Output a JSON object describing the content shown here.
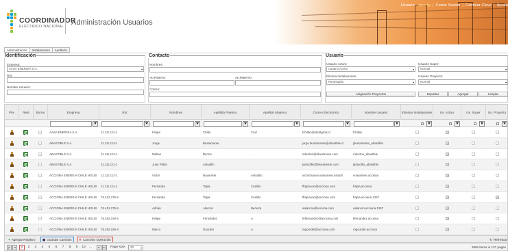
{
  "header": {
    "logo_line1": "COORDINADOR",
    "logo_line2": "ELÉCTRICO NACIONAL",
    "app_title": "Administración Usuarios",
    "user_prefix": "Usuario:",
    "user_name": "qwerty",
    "links": [
      "Cerrar Sesión",
      "Cambiar Clave",
      "Ayuda"
    ]
  },
  "tabs": [
    {
      "label": "Administración"
    },
    {
      "label": "Instalaciones"
    },
    {
      "label": "Auditoría"
    }
  ],
  "identificacion": {
    "legend": "Identificación",
    "empresa_label": "Empresa:",
    "empresa_value": "AASA ENERGÍA S.A.",
    "rut_label": "Rut:",
    "rut_value": "",
    "nombre_usuario_label": "Nombre Usuario:",
    "nombre_usuario_value": ""
  },
  "contacto": {
    "legend": "Contacto",
    "nombres_label": "Nombres:",
    "ap_paterno_label": "Ap.Paterno:",
    "ap_materno_label": "Ap.Materno:",
    "correo_label": "Correo:"
  },
  "usuario": {
    "legend": "Usuario",
    "usuario_activo_label": "Usuario Activo:",
    "usuario_activo_value": "Usuario Activo",
    "usuario_super_label": "Usuario Super:",
    "usuario_super_value": "Normal",
    "elimina_label": "Elimina Instalaciones:",
    "elimina_value": "Restringido",
    "usuario_proyecto_label": "Usuario Proyecto:",
    "usuario_proyecto_value": "Normal",
    "asignacion_button": "Asignación Proyectos",
    "exportar_button": "Exportar",
    "agregar_button": "Agregar",
    "limpiar_button": "Limpiar"
  },
  "grid": {
    "columns": [
      "Priv",
      "Rest",
      "Borrar",
      "Empresa",
      "Rut",
      "Nombres",
      "Apellido Paterno",
      "Apellido Materno",
      "Correo Electrónico",
      "Nombre Usuario",
      "Eliminar Instalaciones",
      "Us. Activo",
      "Us. Super",
      "Us. Proyecto"
    ],
    "rows": [
      {
        "empresa": "AASA ENERGÍA S.A.",
        "rut": "11.111.111-1",
        "nombres": "Felipe",
        "ap_paterno": "Chilla",
        "ap_materno": "Cruz",
        "correo": "fchillac@sbuttgmis.cl",
        "usuario": "fchillac",
        "elim": false,
        "activo": true,
        "super": false,
        "proyecto": false
      },
      {
        "empresa": "ABASTIBLE S.A.",
        "rut": "11.111.112-1",
        "nombres": "Jorge",
        "ap_paterno": "Bustamante",
        "ap_materno": "",
        "correo": "jorge.bustamante@abastible.cl",
        "usuario": "jbustamante_abastible",
        "elim": false,
        "activo": true,
        "super": false,
        "proyecto": false
      },
      {
        "empresa": "ABASTIBLE S.A.",
        "rut": "11.111.112-1",
        "nombres": "Matias",
        "ap_paterno": "Burton",
        "ap_materno": ".",
        "correo": "mburton@bluestream.com",
        "usuario": "mburton_abastible",
        "elim": false,
        "activo": true,
        "super": false,
        "proyecto": false
      },
      {
        "empresa": "ABASTIBLE S.A.",
        "rut": "11.111.111-1",
        "nombres": "Juan Pablo",
        "ap_paterno": "Astudillo",
        "ap_materno": ".",
        "correo": "jastudillo@bluestream.com",
        "usuario": "jastudillo_abastible",
        "elim": false,
        "activo": true,
        "super": false,
        "proyecto": false
      },
      {
        "empresa": "ACCIONA ENERGÍA CHILE HOLDI",
        "rut": "11.111.111-1",
        "nombres": "Victor",
        "ap_paterno": "Navarrete",
        "ap_materno": "Astudillo",
        "correo": "victormanuel.navarrete.astudil",
        "usuario": "vnavarrete.acciona",
        "elim": false,
        "activo": true,
        "super": false,
        "proyecto": false
      },
      {
        "empresa": "ACCIONA ENERGÍA CHILE HOLDI",
        "rut": "11.111.111-1",
        "nombres": "Fernanda",
        "ap_paterno": "Tapia",
        "ap_materno": "Castillo",
        "correo": "fftapia.ext@acciona.com",
        "usuario": "ftapia.acciona",
        "elim": false,
        "activo": true,
        "super": false,
        "proyecto": false
      },
      {
        "empresa": "ACCIONA ENERGÍA CHILE HOLDI",
        "rut": "76.412.275-5",
        "nombres": "Fernanda",
        "ap_paterno": "Tapia",
        "ap_materno": "Castillo",
        "correo": "fftapia.ext@acciona.com",
        "usuario": "ftapia.acciona.1257",
        "elim": false,
        "activo": true,
        "super": false,
        "proyecto": true
      },
      {
        "empresa": "ACCIONA ENERGÍA CHILE HOLDI",
        "rut": "76.412.275-5",
        "nombres": "Adrián",
        "ap_paterno": "Alarcón",
        "ap_materno": "Becerra",
        "correo": "aalarcon@acciona.com",
        "usuario": "aalarcon.acciona.1257",
        "elim": false,
        "activo": true,
        "super": false,
        "proyecto": false
      },
      {
        "empresa": "ACCIONA ENERGÍA CHILE HOLDI",
        "rut": "76.492.150-4",
        "nombres": "Felipe",
        "ap_paterno": "Fernández",
        "ap_materno": "A.",
        "correo": "fefernandez@acciona.com",
        "usuario": "ffernandez.acciona",
        "elim": false,
        "activo": true,
        "super": false,
        "proyecto": false
      },
      {
        "empresa": "ACCIONA ENERGÍA CHILE HOLDI",
        "rut": "76.492.150-4",
        "nombres": "Marco",
        "ap_paterno": "Gourdet",
        "ap_materno": "A.",
        "correo": "mgourdet@acciona.com",
        "usuario": "mgourdet.acciona",
        "elim": false,
        "activo": true,
        "super": false,
        "proyecto": false
      }
    ]
  },
  "actions": {
    "add": "Agregar Registro",
    "save": "Guardar Cambios",
    "cancel": "Cancelar Operación",
    "refresh": "Refrescar"
  },
  "pager": {
    "pages": [
      "1",
      "2",
      "3",
      "4",
      "5",
      "6",
      "7",
      "8",
      "9",
      "10",
      "..."
    ],
    "current_page": "1",
    "page_size_label": "Page size:",
    "page_size_value": "20",
    "info": "2592 items in 127 pages"
  },
  "colors": {
    "banner_orange": "#ef9a4e",
    "save_border": "#4a90d9",
    "cancel_border": "#d9534f"
  }
}
